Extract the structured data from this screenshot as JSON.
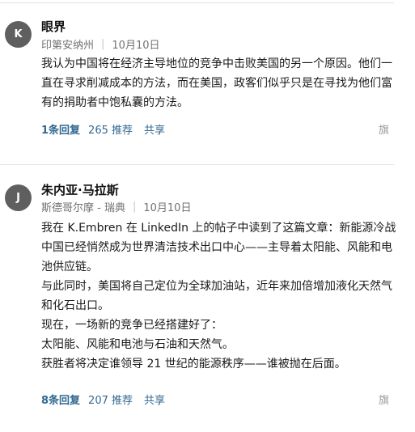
{
  "comments": [
    {
      "avatar_letter": "K",
      "name": "眼界",
      "location": "印第安纳州",
      "date": "10月10日",
      "body": [
        "我认为中国将在经济主导地位的竞争中击败美国的另一个原因。他们一直在寻求削减成本的方法，而在美国，政客们似乎只是在寻找为他们富有的捐助者中饱私囊的方法。"
      ],
      "replies": "1条回复",
      "recommend_count": "265",
      "recommend_label": "推荐",
      "share": "共享",
      "flag": "旗"
    },
    {
      "avatar_letter": "J",
      "name": "朱内亚·马拉斯",
      "location": "斯德哥尔摩 - 瑞典",
      "date": "10月10日",
      "body": [
        "我在 K.Embren 在 LinkedIn 上的帖子中读到了这篇文章：新能源冷战",
        "中国已经悄然成为世界清洁技术出口中心——主导着太阳能、风能和电池供应链。",
        "与此同时，美国将自己定位为全球加油站，近年来加倍增加液化天然气和化石出口。",
        "现在，一场新的竞争已经搭建好了：",
        "太阳能、风能和电池与石油和天然气。",
        "获胜者将决定谁领导 21 世纪的能源秩序——谁被抛在后面。"
      ],
      "replies": "8条回复",
      "recommend_count": "207",
      "recommend_label": "推荐",
      "share": "共享",
      "flag": "旗"
    }
  ]
}
